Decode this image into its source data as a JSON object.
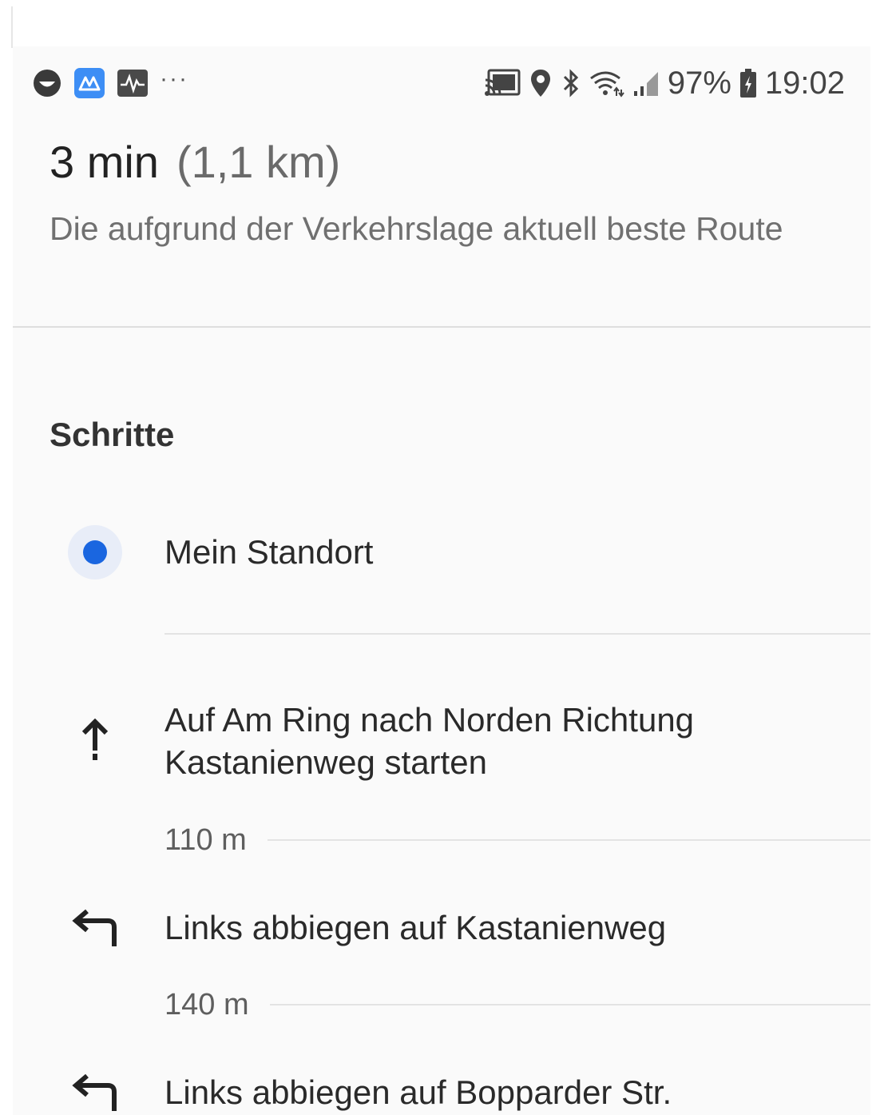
{
  "status_bar": {
    "left_icons": [
      "face-icon",
      "app-icon",
      "activity-icon"
    ],
    "more_indicator": "···",
    "right_icons": [
      "cast-icon",
      "location-pin-icon",
      "bluetooth-icon",
      "wifi-icon",
      "signal-icon"
    ],
    "battery_percent": "97%",
    "battery_icon": "battery-charging-icon",
    "time": "19:02",
    "accent_color": "#3d8ef5"
  },
  "route_summary": {
    "duration": "3 min",
    "distance": "(1,1 km)",
    "description": "Die aufgrund der Verkehrslage aktuell beste Route"
  },
  "steps": {
    "heading": "Schritte",
    "start": {
      "label": "Mein Standort",
      "icon": "current-location-icon",
      "color": "#1a66e0"
    },
    "items": [
      {
        "icon": "arrow-up-icon",
        "instruction": "Auf Am Ring nach Norden Richtung Kastanienweg starten",
        "distance": "110 m"
      },
      {
        "icon": "turn-left-icon",
        "instruction": "Links abbiegen auf Kastanienweg",
        "distance": "140 m"
      },
      {
        "icon": "turn-left-icon",
        "instruction": "Links abbiegen auf Boppard­er Str."
      }
    ]
  }
}
